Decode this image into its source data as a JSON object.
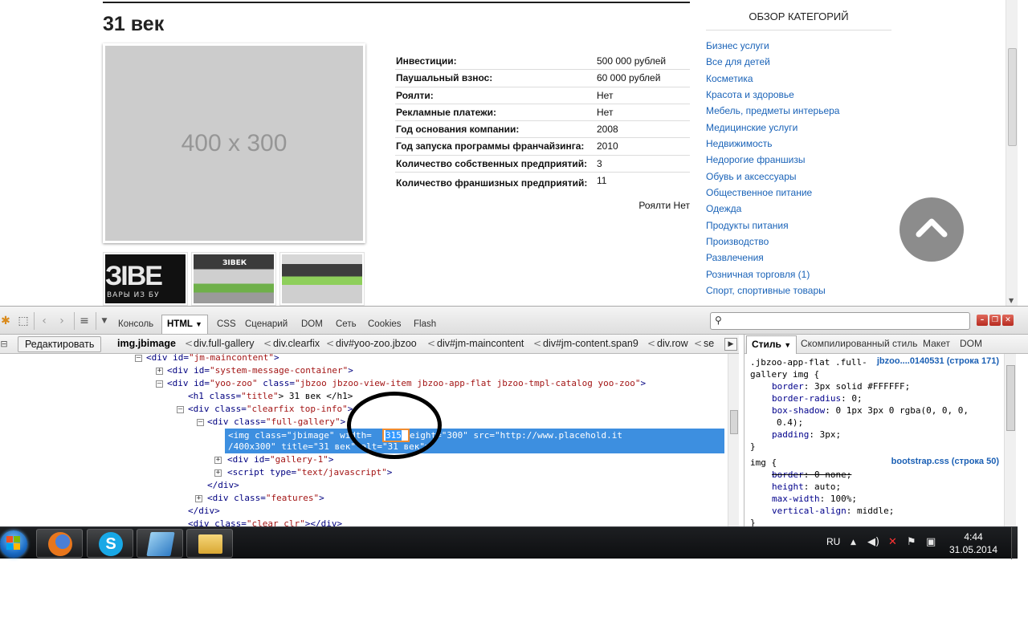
{
  "page": {
    "title": "31 век",
    "main_image_label": "400 x 300",
    "thumbs": [
      {
        "caption_logo": "ЗIВЕ",
        "caption_sub": "ВАРЫ ИЗ БУ"
      },
      {
        "caption_logo": "ЗIВЕК"
      },
      {
        "caption_logo": ""
      }
    ],
    "features": [
      {
        "key": "Инвестиции:",
        "value": "500 000 рублей"
      },
      {
        "key": "Паушальный взнос:",
        "value": "60 000 рублей"
      },
      {
        "key": "Роялти:",
        "value": "Нет"
      },
      {
        "key": "Рекламные платежи:",
        "value": "Нет"
      },
      {
        "key": "Год основания компании:",
        "value": "2008"
      },
      {
        "key": "Год запуска программы франчайзинга:",
        "value": "2010"
      },
      {
        "key": "Количество собственных предприятий:",
        "value": "3"
      },
      {
        "key": "Количество франшизных предприятий:",
        "value": "11"
      }
    ],
    "royalty_note": "Роялти Нет",
    "categories_title": "ОБЗОР КАТЕГОРИЙ",
    "categories": [
      "Бизнес услуги",
      "Все для детей",
      "Косметика",
      "Красота и здоровье",
      "Мебель, предметы интерьера",
      "Медицинские услуги",
      "Недвижимость",
      "Недорогие франшизы",
      "Обувь и аксессуары",
      "Общественное питание",
      "Одежда",
      "Продукты питания",
      "Производство",
      "Развлечения",
      "Розничная торговля (1)",
      "Спорт, спортивные товары"
    ]
  },
  "firebug": {
    "tabs": [
      "Консоль",
      "HTML",
      "CSS",
      "Сценарий",
      "DOM",
      "Сеть",
      "Cookies",
      "Flash"
    ],
    "active_tab": "HTML",
    "search_placeholder": "",
    "edit_button": "Редактировать",
    "breadcrumbs": [
      "img.jbimage",
      "div.full-gallery",
      "div.clearfix",
      "div#yoo-zoo.jbzoo",
      "div#jm-maincontent",
      "div#jm-content.span9",
      "div.row",
      "se"
    ],
    "side_tabs": [
      "Стиль",
      "Скомпилированный стиль",
      "Макет",
      "DOM"
    ],
    "active_side_tab": "Стиль",
    "tree": {
      "l1": {
        "tag": "<div ",
        "attr": "id=",
        "val": "\"jm-maincontent\"",
        "end": ">"
      },
      "l2": {
        "tag": "<div ",
        "attr": "id=",
        "val": "\"system-message-container\"",
        "end": ">"
      },
      "l3": {
        "tag": "<div ",
        "attr": "id=",
        "val": "\"yoo-zoo\"",
        "attr2": " class=",
        "val2": "\"jbzoo jbzoo-view-item jbzoo-app-flat jbzoo-tmpl-catalog yoo-zoo\"",
        "end": ">"
      },
      "l4": {
        "tag": "<h1 ",
        "attr": "class=",
        "val": "\"title\"",
        "text": "> 31 век </h1>"
      },
      "l5": {
        "tag": "<div ",
        "attr": "class=",
        "val": "\"clearfix top-info\"",
        "end": ">"
      },
      "l6": {
        "tag": "<div ",
        "attr": "class=",
        "val": "\"full-gallery\"",
        "end": ">"
      },
      "sel1_pre": "<img class=\"jbimage\" width=",
      "sel1_width": "315",
      "sel1_post": " height=\"300\" src=\"http://www.placehold.it",
      "sel2": "/400x300\" title=\"31 век\" alt=\"31 век\">",
      "l8": {
        "tag": "<div ",
        "attr": "id=",
        "val": "\"gallery-1\"",
        "end": ">"
      },
      "l9": {
        "tag": "<script ",
        "attr": "type=",
        "val": "\"text/javascript\"",
        "end": ">"
      },
      "l10": "</div>",
      "l11": {
        "tag": "<div ",
        "attr": "class=",
        "val": "\"features\"",
        "end": ">"
      },
      "l12": "</div>",
      "l13": {
        "tag": "<div ",
        "attr": "class=",
        "val": "\"clear clr\"",
        "end": "></div>"
      }
    },
    "css_rules": {
      "r1_sel1": ".jbzoo-app-flat .full-",
      "r1_src": "jbzoo....0140531 (строка 171)",
      "r1_sel2": "gallery img {",
      "r1_props": [
        {
          "p": "border",
          "v": "3px solid #FFFFFF;"
        },
        {
          "p": "border-radius",
          "v": "0;"
        },
        {
          "p": "box-shadow",
          "v": "0 1px 3px 0 rgba(0, 0, 0,"
        },
        {
          "p": "",
          "v": "0.4);"
        },
        {
          "p": "padding",
          "v": "3px;"
        }
      ],
      "r1_close": "}",
      "r2_sel": "img {",
      "r2_src": "bootstrap.css (строка 50)",
      "r2_props": [
        {
          "p": "border",
          "v": "0 none;"
        },
        {
          "p": "height",
          "v": "auto;"
        },
        {
          "p": "max-width",
          "v": "100%;"
        },
        {
          "p": "vertical-align",
          "v": "middle;"
        }
      ],
      "r2_close": "}"
    }
  },
  "taskbar": {
    "lang": "RU",
    "time": "4:44",
    "date": "31.05.2014"
  },
  "colors": {
    "link": "#1a63b8",
    "selection": "#3d8fe0",
    "scroll_button": "#8c8c8c"
  }
}
